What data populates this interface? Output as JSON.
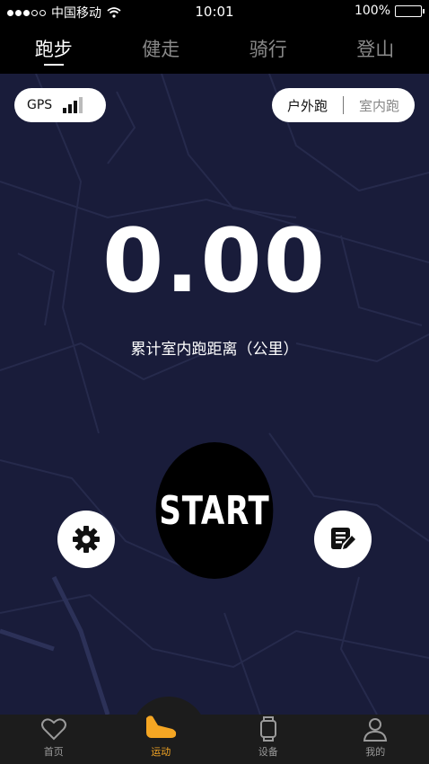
{
  "status_bar": {
    "carrier": "中国移动",
    "time": "10:01",
    "battery": "100%"
  },
  "tabs": [
    {
      "label": "跑步",
      "active": true
    },
    {
      "label": "健走",
      "active": false
    },
    {
      "label": "骑行",
      "active": false
    },
    {
      "label": "登山",
      "active": false
    }
  ],
  "gps": {
    "label": "GPS",
    "icon": "signal-bars-icon"
  },
  "mode": {
    "outdoor": "户外跑",
    "indoor": "室内跑",
    "selected": "户外跑"
  },
  "distance": {
    "value": "0.00",
    "label": "累计室内跑距离（公里）"
  },
  "start_label": "START",
  "actions": {
    "settings_icon": "gear-icon",
    "notes_icon": "notes-edit-icon"
  },
  "bottom_nav": [
    {
      "label": "首页",
      "icon": "heart-icon",
      "active": false
    },
    {
      "label": "运动",
      "icon": "running-shoe-icon",
      "active": true
    },
    {
      "label": "设备",
      "icon": "watch-icon",
      "active": false
    },
    {
      "label": "我的",
      "icon": "person-icon",
      "active": false
    }
  ],
  "colors": {
    "background": "#191c3a",
    "accent": "#f5a623",
    "tab_inactive": "#8a8a8a"
  }
}
